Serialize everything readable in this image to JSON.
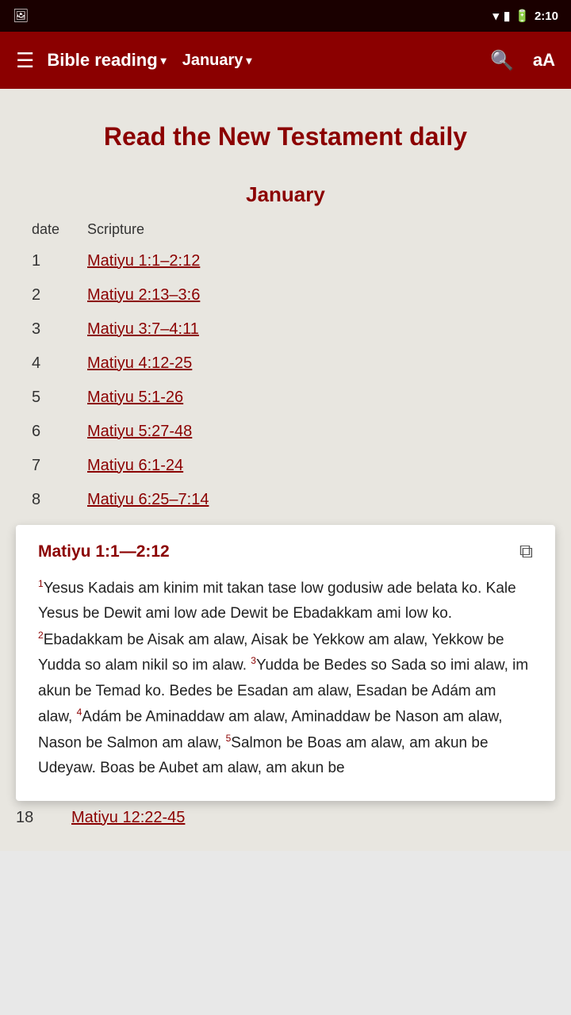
{
  "statusBar": {
    "time": "2:10",
    "icons": [
      "wifi",
      "signal",
      "battery"
    ]
  },
  "toolbar": {
    "menuIcon": "☰",
    "title": "Bible reading",
    "titleArrow": "▾",
    "month": "January",
    "monthArrow": "▾",
    "searchIcon": "search",
    "fontIcon": "aA"
  },
  "page": {
    "heading": "Read the New Testament daily",
    "monthHeading": "January",
    "columns": {
      "date": "date",
      "scripture": "Scripture"
    },
    "readings": [
      {
        "day": "1",
        "ref": "Matiyu 1:1–2:12"
      },
      {
        "day": "2",
        "ref": "Matiyu 2:13–3:6"
      },
      {
        "day": "3",
        "ref": "Matiyu 3:7–4:11"
      },
      {
        "day": "4",
        "ref": "Matiyu 4:12-25"
      },
      {
        "day": "5",
        "ref": "Matiyu 5:1-26"
      },
      {
        "day": "6",
        "ref": "Matiyu 5:27-48"
      },
      {
        "day": "7",
        "ref": "Matiyu 6:1-24"
      },
      {
        "day": "8",
        "ref": "Matiyu 6:25–7:14"
      }
    ],
    "popup": {
      "title": "Matiyu 1:1—2:12",
      "text": "Yesus Kadais am kinim mit takan tase low godusiw ade belata ko. Kale Yesus be Dewit ami low ade Dewit be Ebadakkam ami low ko. Ebadakkam be Aisak am alaw, Aisak be Yekkow am alaw, Yekkow be Yudda so alam nikil so im alaw. Yudda be Bedes so Sada so imi alaw, im akun be Temad ko. Bedes be Esadan am alaw, Esadan be Adám am alaw, Adám be Aminaddaw am alaw, Aminaddaw be Nason am alaw, Nason be Salmon am alaw, Salmon be Boas am alaw, am akun be Udeyaw. Boas be Aubet am alaw, am akun be",
      "verseNumbers": [
        "1",
        "2",
        "3",
        "4",
        "5"
      ],
      "verses": {
        "1": "Yesus Kadais am kinim mit takan tase low godusiw ade belata ko. Kale Yesus be Dewit ami low ade Dewit be Ebadakkam ami low ko.",
        "2": "Ebadakkam be Aisak am alaw, Aisak be Yekkow am alaw, Yekkow be Yudda so alam nikil so im alaw.",
        "3": "Yudda be Bedes so Sada so imi alaw, im akun be Temad ko. Bedes be Esadan am alaw, Esadan be Adám am alaw,",
        "4": "Adám be Aminaddaw am alaw, Aminaddaw be Nason am alaw, Nason be Salmon am alaw,",
        "5": "Salmon be Boas am alaw, am akun be Udeyaw. Boas be Aubet am alaw, am akun be"
      }
    },
    "bottomReading": {
      "day": "18",
      "ref": "Matiyu 12:22-45"
    }
  }
}
